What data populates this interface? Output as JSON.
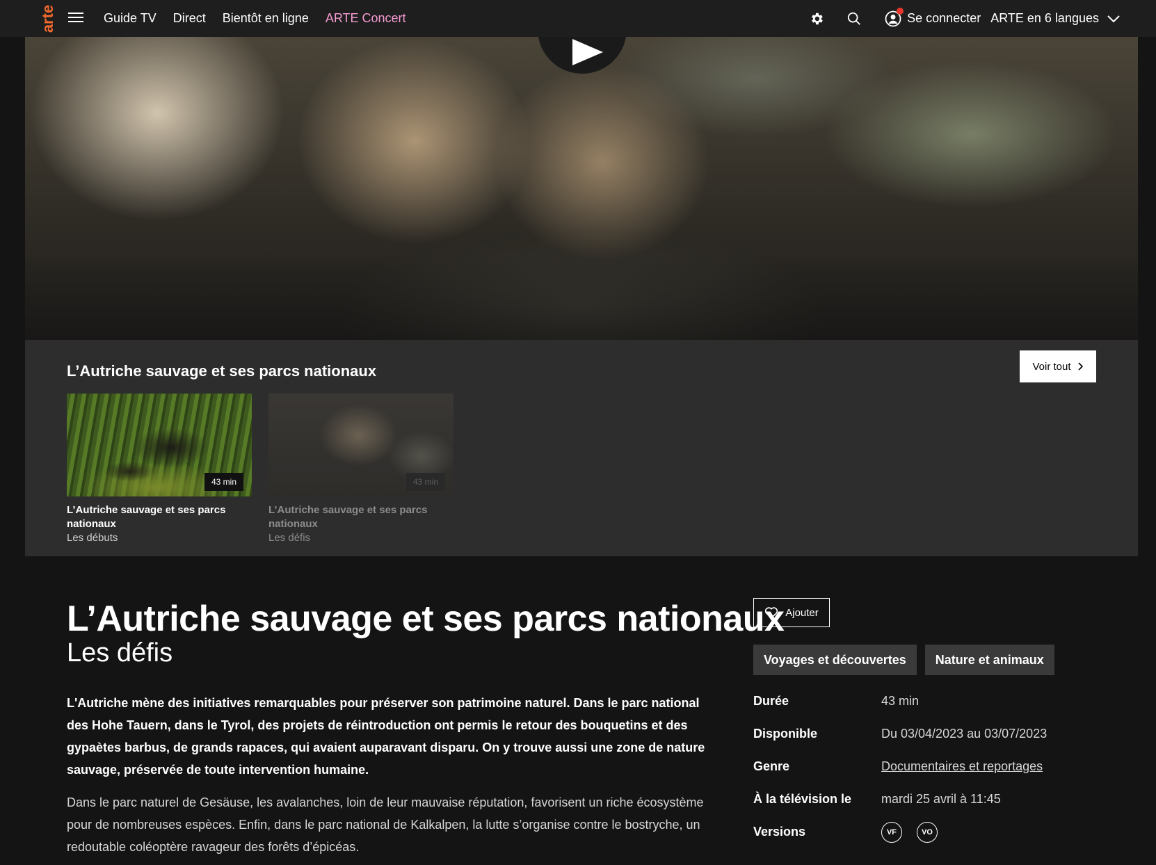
{
  "header": {
    "logo": "arte",
    "nav": [
      "Guide TV",
      "Direct",
      "Bientôt en ligne",
      "ARTE Concert"
    ],
    "connect_label": "Se connecter",
    "language_label": "ARTE en 6 langues",
    "accent_color": "#f49bd1"
  },
  "collection": {
    "title": "L’Autriche sauvage et ses parcs nationaux",
    "see_all_label": "Voir tout",
    "items": [
      {
        "title": "L’Autriche sauvage et ses parcs nationaux",
        "subtitle": "Les débuts",
        "duration": "43 min"
      },
      {
        "title": "L’Autriche sauvage et ses parcs nationaux",
        "subtitle": "Les défis",
        "duration": "43 min"
      }
    ]
  },
  "program": {
    "title": "L’Autriche sauvage et ses parcs nationaux",
    "subtitle": "Les défis",
    "summary": "L'Autriche mène des initiatives remarquables pour préserver son patrimoine naturel. Dans le parc national des Hohe Tauern, dans le Tyrol, des projets de réintroduction ont permis le retour des bouquetins et des gypaètes barbus, de grands rapaces, qui avaient auparavant disparu. On y trouve aussi une zone de nature sauvage, préservée de toute intervention humaine.",
    "description": "Dans le parc naturel de Gesäuse, les avalanches, loin de leur mauvaise réputation, favorisent un riche écosystème pour de nombreuses espèces. Enfin, dans le parc national de Kalkalpen, la lutte s’organise contre le bostryche, un redoutable coléoptère ravageur des forêts d’épicéas.",
    "add_label": "Ajouter",
    "tags": [
      "Voyages et découvertes",
      "Nature et animaux"
    ],
    "info": {
      "duration_label": "Durée",
      "duration": "43 min",
      "available_label": "Disponible",
      "available": "Du 03/04/2023 au 03/07/2023",
      "genre_label": "Genre",
      "genre": "Documentaires et reportages",
      "tv_label": "À la télévision le",
      "tv": "mardi 25 avril à 11:45",
      "versions_label": "Versions",
      "versions": [
        "VF",
        "VO"
      ]
    }
  }
}
